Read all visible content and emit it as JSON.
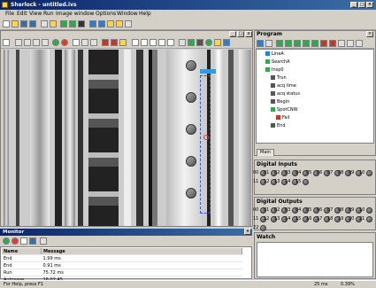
{
  "window": {
    "title": "Sherlock - untitled.ivs"
  },
  "menu": [
    "File",
    "Edit",
    "View",
    "Run",
    "Image window",
    "Options",
    "Window",
    "Help"
  ],
  "image_panel": {
    "close": "x"
  },
  "program": {
    "title": "Program",
    "tree": [
      {
        "indent": 1,
        "label": "LineA",
        "icon_color": "#2a7fd4"
      },
      {
        "indent": 1,
        "label": "SearchA",
        "icon_color": "#2fa84f"
      },
      {
        "indent": 1,
        "label": "Insp0",
        "icon_color": "#2fa84f"
      },
      {
        "indent": 2,
        "label": "Trun",
        "icon_color": "#555555"
      },
      {
        "indent": 2,
        "label": "acq time",
        "icon_color": "#555555"
      },
      {
        "indent": 2,
        "label": "acq status",
        "icon_color": "#555555"
      },
      {
        "indent": 2,
        "label": "Begin",
        "icon_color": "#555555"
      },
      {
        "indent": 2,
        "label": "SpotCNW",
        "icon_color": "#2fa84f"
      },
      {
        "indent": 3,
        "label": "Fail",
        "icon_color": "#c0392b"
      },
      {
        "indent": 2,
        "label": "End",
        "icon_color": "#555555"
      }
    ],
    "tab": "Main"
  },
  "digital_inputs": {
    "title": "Digital Inputs",
    "labels": [
      "00",
      "01",
      "02",
      "03",
      "04",
      "05",
      "06",
      "07",
      "08",
      "09",
      "10",
      "11",
      "12",
      "13",
      "14",
      "15"
    ]
  },
  "digital_outputs": {
    "title": "Digital Outputs",
    "labels": [
      "00",
      "01",
      "02",
      "03",
      "04",
      "05",
      "06",
      "07",
      "08",
      "09",
      "10",
      "11",
      "12",
      "13",
      "14",
      "15",
      "16",
      "17",
      "18",
      "19",
      "20",
      "21",
      "22"
    ]
  },
  "watch": {
    "title": "Watch"
  },
  "monitor": {
    "title": "Monitor",
    "columns": [
      "Name",
      "Message"
    ],
    "rows": [
      {
        "name": "End",
        "message": "1.99 ms"
      },
      {
        "name": "End",
        "message": "0.91 ms"
      },
      {
        "name": "Run",
        "message": "75.72 ms"
      },
      {
        "name": "Autosave",
        "message": "16:02:45"
      }
    ]
  },
  "status": {
    "help": "For Help, press F1",
    "zoom": "25 ms",
    "fps": "0.39%"
  },
  "colors": {
    "title_bar": "#0a246a",
    "roi_box": "#3355cc",
    "roi_handle": "#3a9ad9"
  }
}
